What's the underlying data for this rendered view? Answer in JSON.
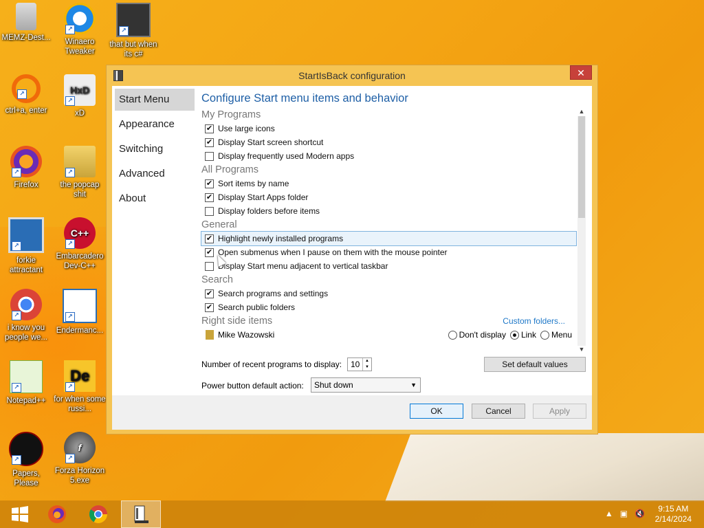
{
  "desktop": {
    "icons": [
      {
        "label": "MEMZ-Dest...",
        "icon": "recycle-bin-icon"
      },
      {
        "label": "Winaero Tweaker",
        "icon": "winaero-icon"
      },
      {
        "label": "that but when its c#",
        "icon": "windows-stack-icon"
      },
      {
        "label": "ctrl+a, enter",
        "icon": "magnifier-icon"
      },
      {
        "label": "xD",
        "icon": "hxd-icon"
      },
      {
        "label": "Firefox",
        "icon": "firefox-icon"
      },
      {
        "label": "the popcap shit",
        "icon": "folder-icon"
      },
      {
        "label": "forkie attractant",
        "icon": "monitor-gear-icon"
      },
      {
        "label": "Embarcadero Dev-C++",
        "icon": "devcpp-icon"
      },
      {
        "label": "i know you people we...",
        "icon": "chrome-icon"
      },
      {
        "label": "Endermanc...",
        "icon": "window-app-icon"
      },
      {
        "label": "Notepad++",
        "icon": "notepadpp-icon"
      },
      {
        "label": "for when some russi...",
        "icon": "de-icon"
      },
      {
        "label": "Papers, Please",
        "icon": "papers-please-icon"
      },
      {
        "label": "Forza Horizon 5.exe",
        "icon": "flash-icon"
      }
    ]
  },
  "window": {
    "title": "StartIsBack configuration",
    "close_label": "✕",
    "nav": [
      "Start Menu",
      "Appearance",
      "Switching",
      "Advanced",
      "About"
    ],
    "heading": "Configure Start menu items and behavior",
    "groups": [
      {
        "title": "My Programs",
        "items": [
          {
            "label": "Use large icons",
            "checked": true
          },
          {
            "label": "Display Start screen shortcut",
            "checked": true
          },
          {
            "label": "Display frequently used Modern apps",
            "checked": false
          }
        ]
      },
      {
        "title": "All Programs",
        "items": [
          {
            "label": "Sort items by name",
            "checked": true
          },
          {
            "label": "Display Start Apps folder",
            "checked": true
          },
          {
            "label": "Display folders before items",
            "checked": false
          }
        ]
      },
      {
        "title": "General",
        "items": [
          {
            "label": "Highlight newly installed programs",
            "checked": true
          },
          {
            "label": "Open submenus when I pause on them with the mouse pointer",
            "checked": true
          },
          {
            "label": "Display Start menu adjacent to vertical taskbar",
            "checked": false
          }
        ]
      },
      {
        "title": "Search",
        "items": [
          {
            "label": "Search programs and settings",
            "checked": true
          },
          {
            "label": "Search public folders",
            "checked": true
          }
        ]
      }
    ],
    "right_side": {
      "title": "Right side items",
      "custom_link": "Custom folders...",
      "item_label": "Mike Wazowski",
      "options": [
        "Don't display",
        "Link",
        "Menu"
      ],
      "selected": "Link"
    },
    "recent_label": "Number of recent programs to display:",
    "recent_value": "10",
    "set_default_label": "Set default values",
    "power_label": "Power button default action:",
    "power_value": "Shut down",
    "ok_label": "OK",
    "cancel_label": "Cancel",
    "apply_label": "Apply"
  },
  "taskbar": {
    "time": "9:15 AM",
    "date": "2/14/2024"
  },
  "colors": {
    "accent": "#1e5fa6",
    "window_frame": "#f5c453",
    "close": "#c7413a"
  }
}
